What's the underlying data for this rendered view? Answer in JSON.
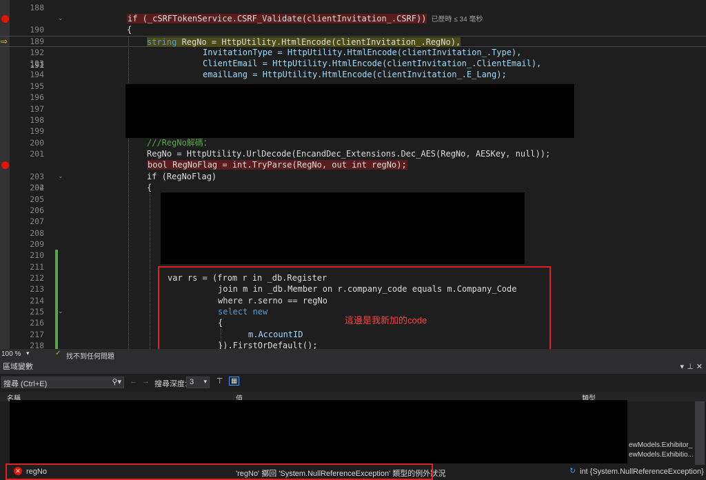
{
  "editor": {
    "lines": [
      {
        "num": "188"
      },
      {
        "num": "189",
        "text": "if (_cSRFTokenService.CSRF_Validate(clientInvitation_.CSRF))",
        "hint": "已歷時 ≤ 34 毫秒"
      },
      {
        "num": "190",
        "text": "{"
      },
      {
        "num": "191",
        "text_a": "string",
        "text_b": " RegNo = HttpUtility.HtmlEncode(clientInvitation_.RegNo),"
      },
      {
        "num": "192",
        "text": "InvitationType = HttpUtility.HtmlEncode(clientInvitation_.Type),"
      },
      {
        "num": "193",
        "text": "ClientEmail = HttpUtility.HtmlEncode(clientInvitation_.ClientEmail),"
      },
      {
        "num": "194",
        "text": "emailLang = HttpUtility.HtmlEncode(clientInvitation_.E_Lang);"
      },
      {
        "num": "195"
      },
      {
        "num": "196"
      },
      {
        "num": "197"
      },
      {
        "num": "198"
      },
      {
        "num": "199"
      },
      {
        "num": "200",
        "text": "///RegNo解碼："
      },
      {
        "num": "201",
        "text": "RegNo = HttpUtility.UrlDecode(EncandDec_Extensions.Dec_AES(RegNo, AESKey, null));"
      },
      {
        "num": "202",
        "text": "bool RegNoFlag = int.TryParse(RegNo, out int regNo);"
      },
      {
        "num": "203",
        "text": "if (RegNoFlag)"
      },
      {
        "num": "204",
        "text": "{"
      },
      {
        "num": "205"
      },
      {
        "num": "206"
      },
      {
        "num": "207"
      },
      {
        "num": "208"
      },
      {
        "num": "209"
      },
      {
        "num": "210"
      },
      {
        "num": "211"
      },
      {
        "num": "212",
        "text": "var rs = (from r in _db.Register"
      },
      {
        "num": "213",
        "text": "join m in _db.Member on r.company_code equals m.Company_Code"
      },
      {
        "num": "214",
        "text": "where r.serno == regNo"
      },
      {
        "num": "215",
        "text": "select new"
      },
      {
        "num": "216",
        "text": "{"
      },
      {
        "num": "217",
        "text": "m.AccountID"
      },
      {
        "num": "218",
        "text": "}).FirstOrDefault();"
      }
    ],
    "annotation": "這邊是我新加的code"
  },
  "statusbar": {
    "zoom": "100 %",
    "issues": "找不到任何問題"
  },
  "locals": {
    "title": "區域變數",
    "search_placeholder": "搜尋 (Ctrl+E)",
    "search_depth_label": "搜尋深度:",
    "search_depth_value": "3",
    "col_name": "名稱",
    "col_value": "值",
    "col_type": "類型",
    "row1_type": "ewModels.Exhibitor_",
    "row2_type": "ewModels.Exhibitio...",
    "error_row": {
      "name": "regNo",
      "value": "'regNo' 擲回 'System.NullReferenceException' 類型的例外狀況",
      "type": "int {System.NullReferenceException}"
    }
  }
}
